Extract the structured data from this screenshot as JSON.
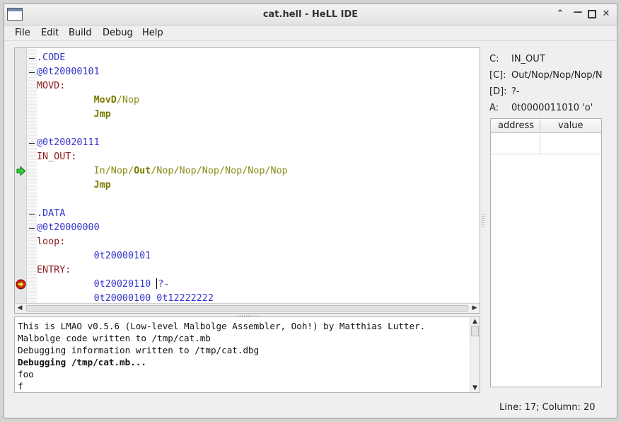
{
  "window": {
    "title": "cat.hell - HeLL IDE"
  },
  "menu": [
    "File",
    "Edit",
    "Build",
    "Debug",
    "Help"
  ],
  "editor": {
    "lines": [
      {
        "fold": true,
        "tokens": [
          {
            "t": ".CODE",
            "c": "blue"
          }
        ]
      },
      {
        "fold": true,
        "tokens": [
          {
            "t": "@0t20000101",
            "c": "blue"
          }
        ]
      },
      {
        "fold": false,
        "tokens": [
          {
            "t": "MOVD:",
            "c": "red"
          }
        ]
      },
      {
        "fold": false,
        "tokens": [
          {
            "t": "          ",
            "c": ""
          },
          {
            "t": "MovD",
            "c": "olive-b"
          },
          {
            "t": "/Nop",
            "c": "olive"
          }
        ]
      },
      {
        "fold": false,
        "tokens": [
          {
            "t": "          ",
            "c": ""
          },
          {
            "t": "Jmp",
            "c": "olive-b"
          }
        ]
      },
      {
        "fold": false,
        "tokens": []
      },
      {
        "fold": true,
        "tokens": [
          {
            "t": "@0t20020111",
            "c": "blue"
          }
        ]
      },
      {
        "fold": false,
        "tokens": [
          {
            "t": "IN_OUT:",
            "c": "red"
          }
        ]
      },
      {
        "fold": false,
        "marker": "arrow",
        "tokens": [
          {
            "t": "          ",
            "c": ""
          },
          {
            "t": "In/Nop/",
            "c": "olive"
          },
          {
            "t": "Out",
            "c": "olive-b"
          },
          {
            "t": "/Nop/Nop/Nop/Nop/Nop/Nop",
            "c": "olive"
          }
        ]
      },
      {
        "fold": false,
        "tokens": [
          {
            "t": "          ",
            "c": ""
          },
          {
            "t": "Jmp",
            "c": "olive-b"
          }
        ]
      },
      {
        "fold": false,
        "tokens": []
      },
      {
        "fold": true,
        "tokens": [
          {
            "t": ".DATA",
            "c": "blue"
          }
        ]
      },
      {
        "fold": true,
        "tokens": [
          {
            "t": "@0t20000000",
            "c": "blue"
          }
        ]
      },
      {
        "fold": false,
        "tokens": [
          {
            "t": "loop:",
            "c": "red"
          }
        ]
      },
      {
        "fold": false,
        "tokens": [
          {
            "t": "          ",
            "c": ""
          },
          {
            "t": "0t20000101",
            "c": "blue"
          }
        ]
      },
      {
        "fold": false,
        "tokens": [
          {
            "t": "ENTRY:",
            "c": "red"
          }
        ]
      },
      {
        "fold": false,
        "marker": "breakpoint",
        "caret": true,
        "tokens": [
          {
            "t": "          ",
            "c": ""
          },
          {
            "t": "0t20020110 ",
            "c": "blue"
          },
          {
            "t": "CARET",
            "c": "caret"
          },
          {
            "t": "?-",
            "c": "blue"
          }
        ]
      },
      {
        "fold": false,
        "tokens": [
          {
            "t": "          ",
            "c": ""
          },
          {
            "t": "0t20000100 0t12222222",
            "c": "blue"
          }
        ]
      }
    ]
  },
  "console": {
    "lines": [
      {
        "text": "This is LMAO v0.5.6 (Low-level Malbolge Assembler, Ooh!) by Matthias Lutter.",
        "bold": false
      },
      {
        "text": "Malbolge code written to /tmp/cat.mb",
        "bold": false
      },
      {
        "text": "Debugging information written to /tmp/cat.dbg",
        "bold": false
      },
      {
        "text": "Debugging /tmp/cat.mb...",
        "bold": true
      },
      {
        "text": "foo",
        "bold": false
      },
      {
        "text": "f",
        "bold": false
      }
    ]
  },
  "registers": [
    {
      "name": "C:",
      "value": "IN_OUT"
    },
    {
      "name": "[C]:",
      "value": "Out/Nop/Nop/Nop/Nop/Nop/Nop"
    },
    {
      "name": "[D]:",
      "value": "?-"
    },
    {
      "name": "A:",
      "value": "0t0000011010 'o'"
    }
  ],
  "memory": {
    "headers": [
      "address",
      "value"
    ]
  },
  "status": {
    "text": "Line: 17; Column: 20"
  },
  "icons": {
    "current": "green-arrow-icon",
    "breakpoint": "breakpoint-icon"
  },
  "colors": {
    "keyword_blue": "#3434cc",
    "label_red": "#8b1a1a",
    "opcode_olive": "#8b8b14"
  }
}
